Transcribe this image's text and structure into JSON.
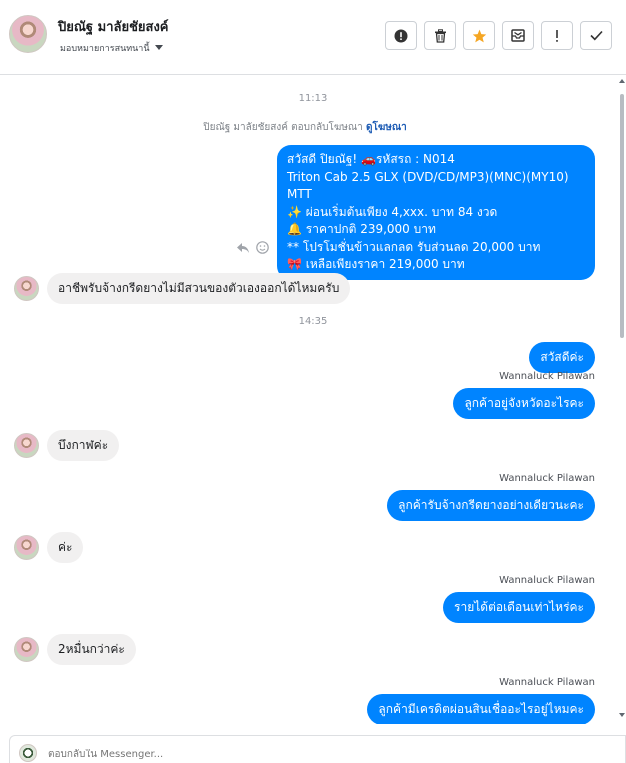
{
  "header": {
    "contact_name": "ปิยณัฐ มาลัยชัยสงค์",
    "assign_label": "มอบหมายการสนทนานี้",
    "toolbar": [
      {
        "name": "spam-alert",
        "icon": "alert-circle-icon"
      },
      {
        "name": "delete",
        "icon": "trash-icon"
      },
      {
        "name": "star",
        "icon": "star-icon"
      },
      {
        "name": "archive",
        "icon": "archive-icon"
      },
      {
        "name": "mark-important",
        "icon": "exclamation-icon"
      },
      {
        "name": "mark-done",
        "icon": "check-icon"
      }
    ]
  },
  "chat": {
    "time_1": "11:13",
    "ad_reply_text": "ปิยณัฐ มาลัยชัยสงค์ ตอบกลับโฆษณา",
    "ad_reply_link": "ดูโฆษณา",
    "ad_message": {
      "line_1": "สวัสดี ปิยณัฐ! 🚗รหัสรถ : N014",
      "line_2": "Triton Cab 2.5 GLX (DVD/CD/MP3)(MNC)(MY10) MTT",
      "line_3": "✨ ผ่อนเริ่มต้นเพียง 4,xxx. บาท 84 งวด",
      "line_4": "🔔 ราคาปกติ 239,000 บาท",
      "line_5": "** โปรโมชั่นข้าวแลกลด รับส่วนลด 20,000 บาท",
      "line_6": "🎀  เหลือเพียงราคา 219,000 บาท"
    },
    "msg_1": "อาชีพรับจ้างกรีดยางไม่มีสวนของตัวเองออกได้ไหมครับ",
    "time_2": "14:35",
    "msg_2": "สวัสดีค่ะ",
    "sender_1": "Wannaluck Pilawan",
    "msg_3": "ลูกค้าอยู่จังหวัดอะไรคะ",
    "msg_4": "บึงกาฬค่ะ",
    "sender_2": "Wannaluck Pilawan",
    "msg_5": "ลูกค้ารับจ้างกรีดยางอย่างเดียวนะคะ",
    "msg_6": "ค่ะ",
    "sender_3": "Wannaluck Pilawan",
    "msg_7": "รายได้ต่อเดือนเท่าไหร่คะ",
    "msg_8": "2หมื่นกว่าค่ะ",
    "sender_4": "Wannaluck Pilawan",
    "msg_9": "ลูกค้ามีเครดิตผ่อนสินเชื่ออะไรอยู่ไหมคะ"
  },
  "composer": {
    "placeholder": "ตอบกลับใน Messenger..."
  },
  "colors": {
    "outgoing_bubble": "#0084ff",
    "incoming_bubble": "#f1f0f0",
    "star": "#f5a623",
    "link": "#1c5bb4"
  }
}
